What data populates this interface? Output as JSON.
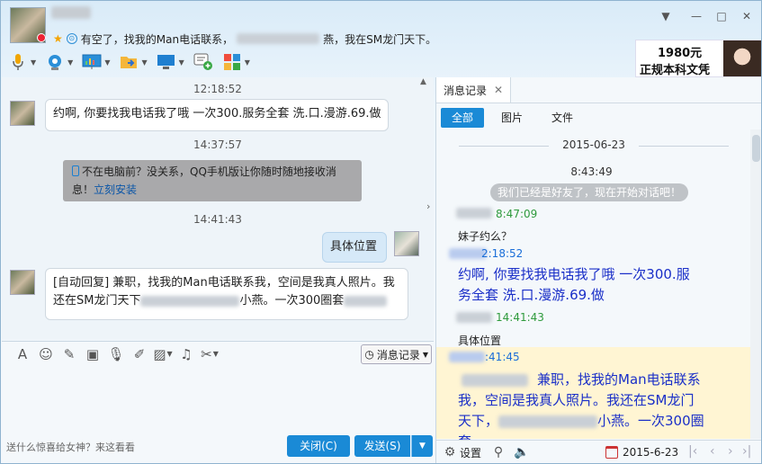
{
  "header": {
    "signature_prefix": "有空了，找我的Man电话联系，",
    "signature_suffix": "燕，我在SM龙门天下。"
  },
  "window_controls": {
    "minimize": "—",
    "maximize": "□",
    "close": "✕",
    "menu": "▼"
  },
  "ad": {
    "price": "1980元",
    "text": "正规本科文凭"
  },
  "chat": {
    "messages": [
      {
        "time": "12:18:52",
        "text": "约啊, 你要找我电话我了哦 一次300.服务全套 洗.口.漫游.69.做"
      },
      {
        "time": "14:37:57"
      },
      {
        "time": "14:41:43",
        "self_text": "具体位置"
      }
    ],
    "notice": {
      "text_line1": "不在电脑前？没关系，QQ手机版让你随时随地接收消",
      "text_line2": "息！",
      "link": "立刻安装"
    },
    "auto_reply": {
      "line1": "[自动回复]  兼职，找我的Man电话联系我，空间是我真人照片。我",
      "line2_prefix": "还在SM龙门天下",
      "line2_mid": "小燕。一次300圈套"
    }
  },
  "input": {
    "history_button": "消息记录",
    "hint": "送什么惊喜给女神？来这看看",
    "close_button": "关闭(C)",
    "send_button": "发送(S)"
  },
  "history": {
    "tab_title": "消息记录",
    "filters": [
      "全部",
      "图片",
      "文件"
    ],
    "date": "2015-06-23",
    "time1": "8:43:49",
    "system_msg": "我们已经是好友了，现在开始对话吧！",
    "meta1": "8:47:09",
    "text1": "妹子约么？",
    "meta2": "2:18:52",
    "blue1_line1": "约啊, 你要找我电话我了哦 一次300.服",
    "blue1_line2": "务全套 洗.口.漫游.69.做",
    "meta3": "14:41:43",
    "text2": "具体位置",
    "meta4": ":41:45",
    "blue2_line1": "兼职，找我的Man电话联系",
    "blue2_line2": "我，空间是我真人照片。我还在SM龙门",
    "blue2_line3_prefix": "天下，",
    "blue2_line3_mid": "小燕。一次300圈",
    "blue2_line4": "套",
    "footer_settings": "设置",
    "footer_date": "2015-6-23"
  }
}
